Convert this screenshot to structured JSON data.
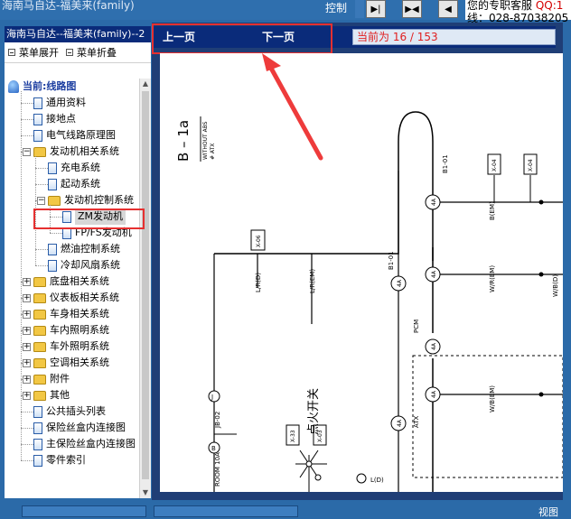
{
  "window": {
    "title_fragment": "海南马自达-福美来(family)",
    "control_label": "控制",
    "service_line1_prefix": "您的专职客服",
    "service_line1_qq": "QQ:1",
    "service_line2": "线：028-87038205"
  },
  "toolbar_buttons": [
    {
      "symbol": "▶|"
    },
    {
      "symbol": "▶◀"
    },
    {
      "symbol": "◀"
    }
  ],
  "left_panel": {
    "title": "海南马自达--福美来(family)--2",
    "expand_all": "菜单展开",
    "collapse_all": "菜单折叠"
  },
  "tree": [
    {
      "level": 0,
      "type": "root",
      "label": "当前:线路图"
    },
    {
      "level": 1,
      "type": "doc",
      "label": "通用资料"
    },
    {
      "level": 1,
      "type": "doc",
      "label": "接地点"
    },
    {
      "level": 1,
      "type": "doc",
      "label": "电气线路原理图"
    },
    {
      "level": 1,
      "type": "folder",
      "expanded": true,
      "label": "发动机相关系统"
    },
    {
      "level": 2,
      "type": "doc",
      "label": "充电系统"
    },
    {
      "level": 2,
      "type": "doc",
      "label": "起动系统"
    },
    {
      "level": 2,
      "type": "folder",
      "expanded": true,
      "label": "发动机控制系统"
    },
    {
      "level": 3,
      "type": "doc",
      "label": "ZM发动机",
      "selected": true
    },
    {
      "level": 3,
      "type": "doc",
      "label": "FP/FS发动机"
    },
    {
      "level": 2,
      "type": "doc",
      "label": "燃油控制系统"
    },
    {
      "level": 2,
      "type": "doc",
      "label": "冷却风扇系统"
    },
    {
      "level": 1,
      "type": "folder",
      "expanded": false,
      "label": "底盘相关系统"
    },
    {
      "level": 1,
      "type": "folder",
      "expanded": false,
      "label": "仪表板相关系统"
    },
    {
      "level": 1,
      "type": "folder",
      "expanded": false,
      "label": "车身相关系统"
    },
    {
      "level": 1,
      "type": "folder",
      "expanded": false,
      "label": "车内照明系统"
    },
    {
      "level": 1,
      "type": "folder",
      "expanded": false,
      "label": "车外照明系统"
    },
    {
      "level": 1,
      "type": "folder",
      "expanded": false,
      "label": "空调相关系统"
    },
    {
      "level": 1,
      "type": "folder",
      "expanded": false,
      "label": "附件"
    },
    {
      "level": 1,
      "type": "folder",
      "expanded": false,
      "label": "其他"
    },
    {
      "level": 1,
      "type": "doc",
      "label": "公共插头列表"
    },
    {
      "level": 1,
      "type": "doc",
      "label": "保险丝盒内连接图"
    },
    {
      "level": 1,
      "type": "doc",
      "label": "主保险丝盒内连接图"
    },
    {
      "level": 1,
      "type": "doc",
      "label": "零件索引"
    }
  ],
  "nav": {
    "prev": "上一页",
    "next": "下一页",
    "page_info": "当前为 16 / 153"
  },
  "diagram": {
    "page_id": "B – 1a",
    "note1": "WITHOUT ABS",
    "note2": "# ATX",
    "connectors": [
      "X-06",
      "X-04",
      "X-04",
      "X-33",
      "X-03"
    ],
    "terminals": [
      "4A",
      "4A",
      "4A",
      "4A",
      "4A",
      "4A",
      "J",
      "B"
    ],
    "wire_labels": [
      "L/R(D)",
      "L/R(EM)",
      "B(EM)",
      "W/R(EM)",
      "W/B(EM)",
      "W/B(D)",
      "L(D)",
      "B1-01",
      "B1-01",
      "JB-02",
      "ROOM 10A",
      "PCM",
      "ATX"
    ],
    "chinese_label": "点火开关"
  },
  "bottom": {
    "view_label": "视图"
  }
}
